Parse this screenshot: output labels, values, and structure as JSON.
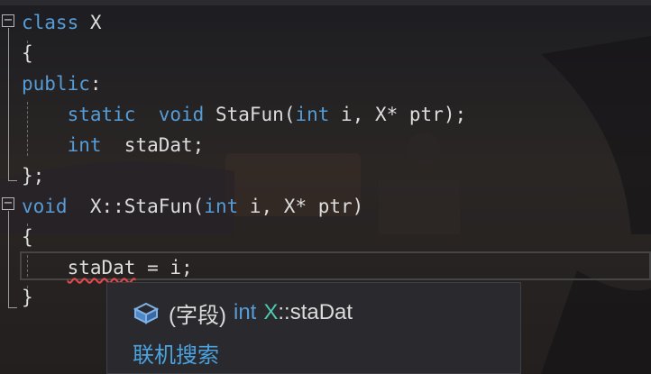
{
  "editor": {
    "lines": [
      {
        "tokens": [
          {
            "t": "class",
            "c": "kw"
          },
          {
            "t": " X",
            "c": "pl"
          }
        ]
      },
      {
        "tokens": [
          {
            "t": "{",
            "c": "pl"
          }
        ]
      },
      {
        "tokens": [
          {
            "t": "public",
            "c": "kw"
          },
          {
            "t": ":",
            "c": "pl"
          }
        ]
      },
      {
        "tokens": [
          {
            "t": "    ",
            "c": "pl"
          },
          {
            "t": "static",
            "c": "kw"
          },
          {
            "t": "  ",
            "c": "pl"
          },
          {
            "t": "void",
            "c": "kw"
          },
          {
            "t": " StaFun(",
            "c": "pl"
          },
          {
            "t": "int",
            "c": "kw"
          },
          {
            "t": " i, X* ptr);",
            "c": "pl"
          }
        ]
      },
      {
        "tokens": [
          {
            "t": "    ",
            "c": "pl"
          },
          {
            "t": "int",
            "c": "kw"
          },
          {
            "t": "  staDat;",
            "c": "pl"
          }
        ]
      },
      {
        "tokens": [
          {
            "t": "};",
            "c": "pl"
          }
        ]
      },
      {
        "tokens": [
          {
            "t": "void",
            "c": "kw"
          },
          {
            "t": "  X::StaFun(",
            "c": "pl"
          },
          {
            "t": "int",
            "c": "kw"
          },
          {
            "t": " i, X* ptr)",
            "c": "pl"
          }
        ]
      },
      {
        "tokens": [
          {
            "t": "{",
            "c": "pl"
          }
        ]
      },
      {
        "tokens": [
          {
            "t": "    ",
            "c": "pl"
          },
          {
            "t": "staDat",
            "c": "pl err-underline"
          },
          {
            "t": " = i;",
            "c": "pl"
          }
        ]
      },
      {
        "tokens": [
          {
            "t": "}",
            "c": "pl"
          }
        ]
      }
    ],
    "collapse_glyph": "−",
    "error_color": "#e5484d",
    "keyword_color": "#569cd6",
    "type_color": "#4ec9b0"
  },
  "tooltip": {
    "icon": "field-cube-icon",
    "kind": "(字段)",
    "type": "int",
    "class": "X",
    "separator": "::",
    "member": "staDat",
    "online_search": "联机搜索"
  }
}
